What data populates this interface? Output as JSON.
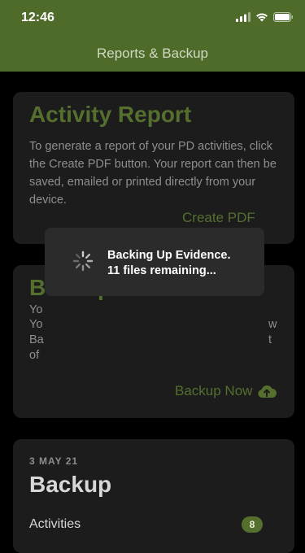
{
  "status_bar": {
    "time": "12:46"
  },
  "nav": {
    "title": "Reports & Backup"
  },
  "report_card": {
    "heading": "Activity Report",
    "body": "To generate a report of your PD activities, click the Create PDF button. Your report can then be saved, emailed or printed directly from your device.",
    "action": "Create PDF"
  },
  "backups_card": {
    "heading": "Backups Enabled",
    "body_lines": [
      "Yo",
      "Yo",
      "Ba",
      "of"
    ],
    "body_right": [
      "w",
      "t"
    ],
    "action": "Backup Now"
  },
  "hud": {
    "line1": "Backing Up Evidence.",
    "line2": "11 files remaining..."
  },
  "summary_card": {
    "date": "3 MAY 21",
    "title": "Backup",
    "row_label": "Activities",
    "row_count": "8"
  },
  "colors": {
    "bar": "#4f6b2a",
    "accent": "#556f2e",
    "card": "#1c1c1c"
  }
}
